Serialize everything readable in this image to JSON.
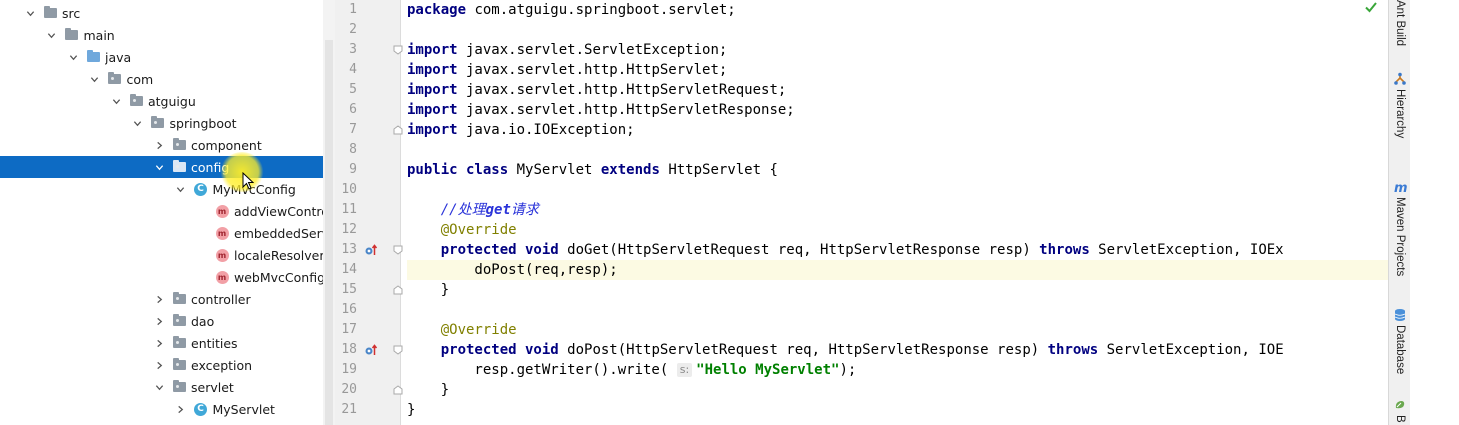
{
  "tree": {
    "items": [
      {
        "label": "src",
        "depth": 1,
        "arrow": "down",
        "icon": "folder",
        "selected": false
      },
      {
        "label": "main",
        "depth": 2,
        "arrow": "down",
        "icon": "folder",
        "selected": false
      },
      {
        "label": "java",
        "depth": 3,
        "arrow": "down",
        "icon": "source-folder",
        "selected": false
      },
      {
        "label": "com",
        "depth": 4,
        "arrow": "down",
        "icon": "package",
        "selected": false
      },
      {
        "label": "atguigu",
        "depth": 5,
        "arrow": "down",
        "icon": "package",
        "selected": false
      },
      {
        "label": "springboot",
        "depth": 6,
        "arrow": "down",
        "icon": "package",
        "selected": false
      },
      {
        "label": "component",
        "depth": 7,
        "arrow": "right",
        "icon": "package",
        "selected": false
      },
      {
        "label": "config",
        "depth": 7,
        "arrow": "down",
        "icon": "package",
        "selected": true
      },
      {
        "label": "MyMvcConfig",
        "depth": 8,
        "arrow": "down",
        "icon": "class",
        "selected": false
      },
      {
        "label": "addViewControlle",
        "depth": 9,
        "arrow": "none",
        "icon": "method",
        "selected": false
      },
      {
        "label": "embeddedServle",
        "depth": 9,
        "arrow": "none",
        "icon": "method",
        "selected": false
      },
      {
        "label": "localeResolver():L",
        "depth": 9,
        "arrow": "none",
        "icon": "method",
        "selected": false
      },
      {
        "label": "webMvcConfigur",
        "depth": 9,
        "arrow": "none",
        "icon": "method",
        "selected": false
      },
      {
        "label": "controller",
        "depth": 7,
        "arrow": "right",
        "icon": "package",
        "selected": false
      },
      {
        "label": "dao",
        "depth": 7,
        "arrow": "right",
        "icon": "package",
        "selected": false
      },
      {
        "label": "entities",
        "depth": 7,
        "arrow": "right",
        "icon": "package",
        "selected": false
      },
      {
        "label": "exception",
        "depth": 7,
        "arrow": "right",
        "icon": "package",
        "selected": false
      },
      {
        "label": "servlet",
        "depth": 7,
        "arrow": "down",
        "icon": "package",
        "selected": false
      },
      {
        "label": "MyServlet",
        "depth": 8,
        "arrow": "right",
        "icon": "class",
        "selected": false
      }
    ]
  },
  "editor": {
    "current_line": 14,
    "lines": [
      {
        "n": "1",
        "tokens": [
          {
            "t": "kw",
            "v": "package"
          },
          {
            "t": "txt",
            "v": " com.atguigu.springboot.servlet;"
          }
        ]
      },
      {
        "n": "2",
        "tokens": []
      },
      {
        "n": "3",
        "fold": "top",
        "tokens": [
          {
            "t": "kw",
            "v": "import"
          },
          {
            "t": "txt",
            "v": " javax.servlet.ServletException;"
          }
        ]
      },
      {
        "n": "4",
        "tokens": [
          {
            "t": "kw",
            "v": "import"
          },
          {
            "t": "txt",
            "v": " javax.servlet.http.HttpServlet;"
          }
        ]
      },
      {
        "n": "5",
        "tokens": [
          {
            "t": "kw",
            "v": "import"
          },
          {
            "t": "txt",
            "v": " javax.servlet.http.HttpServletRequest;"
          }
        ]
      },
      {
        "n": "6",
        "tokens": [
          {
            "t": "kw",
            "v": "import"
          },
          {
            "t": "txt",
            "v": " javax.servlet.http.HttpServletResponse;"
          }
        ]
      },
      {
        "n": "7",
        "fold": "bottom",
        "tokens": [
          {
            "t": "kw",
            "v": "import"
          },
          {
            "t": "txt",
            "v": " java.io.IOException;"
          }
        ]
      },
      {
        "n": "8",
        "tokens": []
      },
      {
        "n": "9",
        "tokens": [
          {
            "t": "kw",
            "v": "public class"
          },
          {
            "t": "txt",
            "v": " MyServlet "
          },
          {
            "t": "kw",
            "v": "extends"
          },
          {
            "t": "txt",
            "v": " HttpServlet {"
          }
        ]
      },
      {
        "n": "10",
        "tokens": []
      },
      {
        "n": "11",
        "tokens": [
          {
            "t": "txt",
            "v": "    "
          },
          {
            "t": "cmt",
            "v": "//处理"
          },
          {
            "t": "cmtb",
            "v": "get"
          },
          {
            "t": "cmt",
            "v": "请求"
          }
        ]
      },
      {
        "n": "12",
        "tokens": [
          {
            "t": "txt",
            "v": "    "
          },
          {
            "t": "ann",
            "v": "@Override"
          }
        ]
      },
      {
        "n": "13",
        "icon": "override",
        "fold": "top",
        "tokens": [
          {
            "t": "txt",
            "v": "    "
          },
          {
            "t": "kw",
            "v": "protected void"
          },
          {
            "t": "txt",
            "v": " doGet(HttpServletRequest req, HttpServletResponse resp) "
          },
          {
            "t": "kw",
            "v": "throws"
          },
          {
            "t": "txt",
            "v": " ServletException, IOEx"
          }
        ]
      },
      {
        "n": "14",
        "tokens": [
          {
            "t": "txt",
            "v": "        doPost(req,resp);"
          }
        ]
      },
      {
        "n": "15",
        "fold": "bottom",
        "tokens": [
          {
            "t": "txt",
            "v": "    }"
          }
        ]
      },
      {
        "n": "16",
        "tokens": []
      },
      {
        "n": "17",
        "tokens": [
          {
            "t": "txt",
            "v": "    "
          },
          {
            "t": "ann",
            "v": "@Override"
          }
        ]
      },
      {
        "n": "18",
        "icon": "override",
        "fold": "top",
        "tokens": [
          {
            "t": "txt",
            "v": "    "
          },
          {
            "t": "kw",
            "v": "protected void"
          },
          {
            "t": "txt",
            "v": " doPost(HttpServletRequest req, HttpServletResponse resp) "
          },
          {
            "t": "kw",
            "v": "throws"
          },
          {
            "t": "txt",
            "v": " ServletException, IOE"
          }
        ]
      },
      {
        "n": "19",
        "tokens": [
          {
            "t": "txt",
            "v": "        resp.getWriter().write( "
          },
          {
            "t": "hint",
            "v": "s:"
          },
          {
            "t": "str",
            "v": "\"Hello MyServlet\""
          },
          {
            "t": "txt",
            "v": ");"
          }
        ]
      },
      {
        "n": "20",
        "fold": "bottom",
        "tokens": [
          {
            "t": "txt",
            "v": "    }"
          }
        ]
      },
      {
        "n": "21",
        "tokens": [
          {
            "t": "txt",
            "v": "}"
          }
        ]
      }
    ]
  },
  "right_panel": {
    "tabs": [
      {
        "label": "Ant Build",
        "icon": "none"
      },
      {
        "label": "Hierarchy",
        "icon": "hierarchy-icon"
      },
      {
        "label": "Maven Projects",
        "icon": "maven-icon"
      },
      {
        "label": "Database",
        "icon": "database-icon"
      },
      {
        "label": "B",
        "icon": "bean-icon"
      }
    ]
  },
  "colors": {
    "selection": "#0d6bc4",
    "keyword": "#000080",
    "annotation": "#808000",
    "comment": "#2b34d9",
    "string": "#008000",
    "current_line": "#fcfae3"
  }
}
